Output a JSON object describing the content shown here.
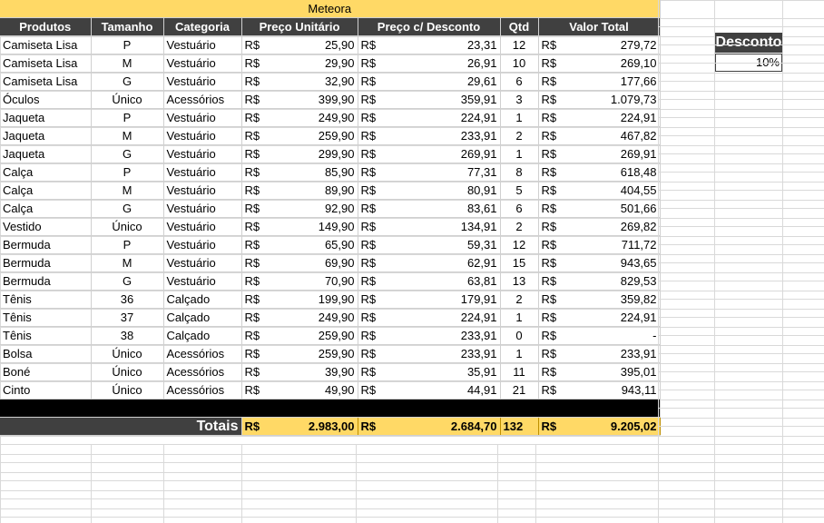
{
  "title": "Meteora",
  "headers": [
    "Produtos",
    "Tamanho",
    "Categoria",
    "Preço Unitário",
    "Preço c/ Desconto",
    "Qtd",
    "Valor Total"
  ],
  "currency": "R$",
  "rows": [
    {
      "produto": "Camiseta Lisa",
      "tamanho": "P",
      "categoria": "Vestuário",
      "preco": "25,90",
      "desconto": "23,31",
      "qtd": "12",
      "total": "279,72"
    },
    {
      "produto": "Camiseta Lisa",
      "tamanho": "M",
      "categoria": "Vestuário",
      "preco": "29,90",
      "desconto": "26,91",
      "qtd": "10",
      "total": "269,10"
    },
    {
      "produto": "Camiseta Lisa",
      "tamanho": "G",
      "categoria": "Vestuário",
      "preco": "32,90",
      "desconto": "29,61",
      "qtd": "6",
      "total": "177,66"
    },
    {
      "produto": "Óculos",
      "tamanho": "Único",
      "categoria": "Acessórios",
      "preco": "399,90",
      "desconto": "359,91",
      "qtd": "3",
      "total": "1.079,73"
    },
    {
      "produto": "Jaqueta",
      "tamanho": "P",
      "categoria": "Vestuário",
      "preco": "249,90",
      "desconto": "224,91",
      "qtd": "1",
      "total": "224,91"
    },
    {
      "produto": "Jaqueta",
      "tamanho": "M",
      "categoria": "Vestuário",
      "preco": "259,90",
      "desconto": "233,91",
      "qtd": "2",
      "total": "467,82"
    },
    {
      "produto": "Jaqueta",
      "tamanho": "G",
      "categoria": "Vestuário",
      "preco": "299,90",
      "desconto": "269,91",
      "qtd": "1",
      "total": "269,91"
    },
    {
      "produto": "Calça",
      "tamanho": "P",
      "categoria": "Vestuário",
      "preco": "85,90",
      "desconto": "77,31",
      "qtd": "8",
      "total": "618,48"
    },
    {
      "produto": "Calça",
      "tamanho": "M",
      "categoria": "Vestuário",
      "preco": "89,90",
      "desconto": "80,91",
      "qtd": "5",
      "total": "404,55"
    },
    {
      "produto": "Calça",
      "tamanho": "G",
      "categoria": "Vestuário",
      "preco": "92,90",
      "desconto": "83,61",
      "qtd": "6",
      "total": "501,66"
    },
    {
      "produto": "Vestido",
      "tamanho": "Único",
      "categoria": "Vestuário",
      "preco": "149,90",
      "desconto": "134,91",
      "qtd": "2",
      "total": "269,82"
    },
    {
      "produto": "Bermuda",
      "tamanho": "P",
      "categoria": "Vestuário",
      "preco": "65,90",
      "desconto": "59,31",
      "qtd": "12",
      "total": "711,72"
    },
    {
      "produto": "Bermuda",
      "tamanho": "M",
      "categoria": "Vestuário",
      "preco": "69,90",
      "desconto": "62,91",
      "qtd": "15",
      "total": "943,65"
    },
    {
      "produto": "Bermuda",
      "tamanho": "G",
      "categoria": "Vestuário",
      "preco": "70,90",
      "desconto": "63,81",
      "qtd": "13",
      "total": "829,53"
    },
    {
      "produto": "Tênis",
      "tamanho": "36",
      "categoria": "Calçado",
      "preco": "199,90",
      "desconto": "179,91",
      "qtd": "2",
      "total": "359,82"
    },
    {
      "produto": "Tênis",
      "tamanho": "37",
      "categoria": "Calçado",
      "preco": "249,90",
      "desconto": "224,91",
      "qtd": "1",
      "total": "224,91"
    },
    {
      "produto": "Tênis",
      "tamanho": "38",
      "categoria": "Calçado",
      "preco": "259,90",
      "desconto": "233,91",
      "qtd": "0",
      "total": "-"
    },
    {
      "produto": "Bolsa",
      "tamanho": "Único",
      "categoria": "Acessórios",
      "preco": "259,90",
      "desconto": "233,91",
      "qtd": "1",
      "total": "233,91"
    },
    {
      "produto": "Boné",
      "tamanho": "Único",
      "categoria": "Acessórios",
      "preco": "39,90",
      "desconto": "35,91",
      "qtd": "11",
      "total": "395,01"
    },
    {
      "produto": "Cinto",
      "tamanho": "Único",
      "categoria": "Acessórios",
      "preco": "49,90",
      "desconto": "44,91",
      "qtd": "21",
      "total": "943,11"
    }
  ],
  "totals": {
    "label": "Totais",
    "preco": "2.983,00",
    "desconto": "2.684,70",
    "qtd": "132",
    "total": "9.205,02"
  },
  "discount": {
    "label": "Desconto",
    "value": "10%"
  },
  "colors": {
    "accent": "#ffd966",
    "header": "#404040"
  }
}
